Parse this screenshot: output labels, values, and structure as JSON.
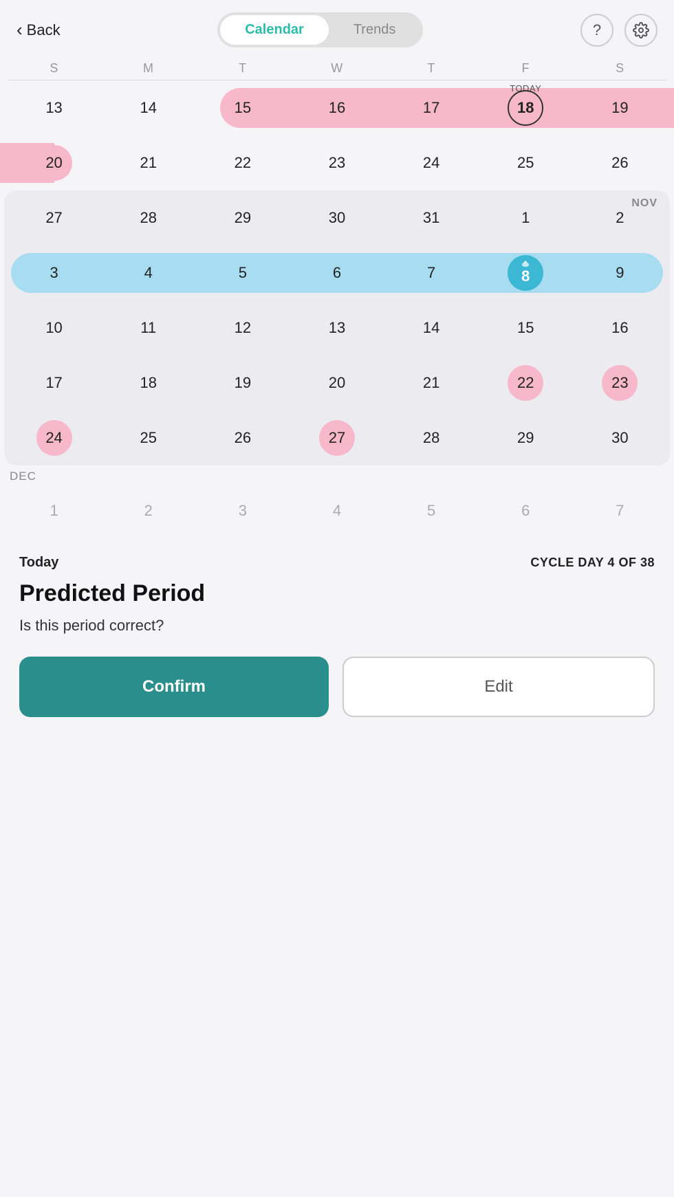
{
  "header": {
    "back_label": "Back",
    "calendar_label": "Calendar",
    "trends_label": "Trends",
    "active_tab": "Calendar"
  },
  "day_headers": [
    "S",
    "M",
    "T",
    "W",
    "T",
    "F",
    "S"
  ],
  "weeks": [
    {
      "id": "week1",
      "section": "oct",
      "days": [
        {
          "num": "13",
          "muted": false,
          "today": false,
          "pink": false,
          "blue": false,
          "ovulation": false,
          "pill_pos": "none"
        },
        {
          "num": "14",
          "muted": false,
          "today": false,
          "pink": false,
          "blue": false,
          "ovulation": false,
          "pill_pos": "none"
        },
        {
          "num": "15",
          "muted": false,
          "today": false,
          "pink": true,
          "blue": false,
          "ovulation": false,
          "pill_pos": "start"
        },
        {
          "num": "16",
          "muted": false,
          "today": false,
          "pink": true,
          "blue": false,
          "ovulation": false,
          "pill_pos": "mid"
        },
        {
          "num": "17",
          "muted": false,
          "today": false,
          "pink": true,
          "blue": false,
          "ovulation": false,
          "pill_pos": "mid"
        },
        {
          "num": "18",
          "muted": false,
          "today": true,
          "pink": true,
          "blue": false,
          "ovulation": false,
          "pill_pos": "mid"
        },
        {
          "num": "19",
          "muted": false,
          "today": false,
          "pink": true,
          "blue": false,
          "ovulation": false,
          "pill_pos": "end"
        }
      ]
    },
    {
      "id": "week2",
      "section": "oct",
      "days": [
        {
          "num": "20",
          "muted": false,
          "today": false,
          "pink": true,
          "blue": false,
          "ovulation": false,
          "pill_pos": "solo"
        },
        {
          "num": "21",
          "muted": false,
          "today": false,
          "pink": false,
          "blue": false,
          "ovulation": false,
          "pill_pos": "none"
        },
        {
          "num": "22",
          "muted": false,
          "today": false,
          "pink": false,
          "blue": false,
          "ovulation": false,
          "pill_pos": "none"
        },
        {
          "num": "23",
          "muted": false,
          "today": false,
          "pink": false,
          "blue": false,
          "ovulation": false,
          "pill_pos": "none"
        },
        {
          "num": "24",
          "muted": false,
          "today": false,
          "pink": false,
          "blue": false,
          "ovulation": false,
          "pill_pos": "none"
        },
        {
          "num": "25",
          "muted": false,
          "today": false,
          "pink": false,
          "blue": false,
          "ovulation": false,
          "pill_pos": "none"
        },
        {
          "num": "26",
          "muted": false,
          "today": false,
          "pink": false,
          "blue": false,
          "ovulation": false,
          "pill_pos": "none"
        }
      ]
    },
    {
      "id": "week3",
      "section": "oct_nov",
      "month_label": "NOV",
      "days": [
        {
          "num": "27",
          "muted": false,
          "today": false,
          "pink": false,
          "blue": false,
          "ovulation": false,
          "pill_pos": "none"
        },
        {
          "num": "28",
          "muted": false,
          "today": false,
          "pink": false,
          "blue": false,
          "ovulation": false,
          "pill_pos": "none"
        },
        {
          "num": "29",
          "muted": false,
          "today": false,
          "pink": false,
          "blue": false,
          "ovulation": false,
          "pill_pos": "none"
        },
        {
          "num": "30",
          "muted": false,
          "today": false,
          "pink": false,
          "blue": false,
          "ovulation": false,
          "pill_pos": "none"
        },
        {
          "num": "31",
          "muted": false,
          "today": false,
          "pink": false,
          "blue": false,
          "ovulation": false,
          "pill_pos": "none"
        },
        {
          "num": "1",
          "muted": false,
          "today": false,
          "pink": false,
          "blue": false,
          "ovulation": false,
          "pill_pos": "none"
        },
        {
          "num": "2",
          "muted": false,
          "today": false,
          "pink": false,
          "blue": false,
          "ovulation": false,
          "pill_pos": "none"
        }
      ]
    },
    {
      "id": "week4",
      "section": "nov",
      "days": [
        {
          "num": "3",
          "muted": false,
          "today": false,
          "pink": false,
          "blue": true,
          "ovulation": false,
          "pill_pos": "start"
        },
        {
          "num": "4",
          "muted": false,
          "today": false,
          "pink": false,
          "blue": true,
          "ovulation": false,
          "pill_pos": "mid"
        },
        {
          "num": "5",
          "muted": false,
          "today": false,
          "pink": false,
          "blue": true,
          "ovulation": false,
          "pill_pos": "mid"
        },
        {
          "num": "6",
          "muted": false,
          "today": false,
          "pink": false,
          "blue": true,
          "ovulation": false,
          "pill_pos": "mid"
        },
        {
          "num": "7",
          "muted": false,
          "today": false,
          "pink": false,
          "blue": true,
          "ovulation": false,
          "pill_pos": "mid"
        },
        {
          "num": "8",
          "muted": false,
          "today": false,
          "pink": false,
          "blue": true,
          "ovulation": true,
          "pill_pos": "mid"
        },
        {
          "num": "9",
          "muted": false,
          "today": false,
          "pink": false,
          "blue": true,
          "ovulation": false,
          "pill_pos": "end"
        }
      ]
    },
    {
      "id": "week5",
      "section": "nov",
      "days": [
        {
          "num": "10",
          "muted": false,
          "today": false,
          "pink": false,
          "blue": false,
          "ovulation": false,
          "pill_pos": "none"
        },
        {
          "num": "11",
          "muted": false,
          "today": false,
          "pink": false,
          "blue": false,
          "ovulation": false,
          "pill_pos": "none"
        },
        {
          "num": "12",
          "muted": false,
          "today": false,
          "pink": false,
          "blue": false,
          "ovulation": false,
          "pill_pos": "none"
        },
        {
          "num": "13",
          "muted": false,
          "today": false,
          "pink": false,
          "blue": false,
          "ovulation": false,
          "pill_pos": "none"
        },
        {
          "num": "14",
          "muted": false,
          "today": false,
          "pink": false,
          "blue": false,
          "ovulation": false,
          "pill_pos": "none"
        },
        {
          "num": "15",
          "muted": false,
          "today": false,
          "pink": false,
          "blue": false,
          "ovulation": false,
          "pill_pos": "none"
        },
        {
          "num": "16",
          "muted": false,
          "today": false,
          "pink": false,
          "blue": false,
          "ovulation": false,
          "pill_pos": "none"
        }
      ]
    },
    {
      "id": "week6",
      "section": "nov",
      "days": [
        {
          "num": "17",
          "muted": false,
          "today": false,
          "pink": false,
          "blue": false,
          "ovulation": false,
          "pill_pos": "none"
        },
        {
          "num": "18",
          "muted": false,
          "today": false,
          "pink": false,
          "blue": false,
          "ovulation": false,
          "pill_pos": "none"
        },
        {
          "num": "19",
          "muted": false,
          "today": false,
          "pink": false,
          "blue": false,
          "ovulation": false,
          "pill_pos": "none"
        },
        {
          "num": "20",
          "muted": false,
          "today": false,
          "pink": false,
          "blue": false,
          "ovulation": false,
          "pill_pos": "none"
        },
        {
          "num": "21",
          "muted": false,
          "today": false,
          "pink": false,
          "blue": false,
          "ovulation": false,
          "pill_pos": "none"
        },
        {
          "num": "22",
          "muted": false,
          "today": false,
          "pink": true,
          "blue": false,
          "ovulation": false,
          "pill_pos": "start"
        },
        {
          "num": "23",
          "muted": false,
          "today": false,
          "pink": true,
          "blue": false,
          "ovulation": false,
          "pill_pos": "end"
        }
      ]
    },
    {
      "id": "week7",
      "section": "nov",
      "days": [
        {
          "num": "24",
          "muted": false,
          "today": false,
          "pink": true,
          "blue": false,
          "ovulation": false,
          "pill_pos": "start"
        },
        {
          "num": "25",
          "muted": false,
          "today": false,
          "pink": true,
          "blue": false,
          "ovulation": false,
          "pill_pos": "mid"
        },
        {
          "num": "26",
          "muted": false,
          "today": false,
          "pink": true,
          "blue": false,
          "ovulation": false,
          "pill_pos": "mid"
        },
        {
          "num": "27",
          "muted": false,
          "today": false,
          "pink": true,
          "blue": false,
          "ovulation": false,
          "pill_pos": "end"
        },
        {
          "num": "28",
          "muted": false,
          "today": false,
          "pink": false,
          "blue": false,
          "ovulation": false,
          "pill_pos": "none"
        },
        {
          "num": "29",
          "muted": false,
          "today": false,
          "pink": false,
          "blue": false,
          "ovulation": false,
          "pill_pos": "none"
        },
        {
          "num": "30",
          "muted": false,
          "today": false,
          "pink": false,
          "blue": false,
          "ovulation": false,
          "pill_pos": "none"
        }
      ]
    }
  ],
  "dec_label": "DEC",
  "partial_dec_days": [
    "1",
    "2",
    "3",
    "4",
    "5",
    "6",
    "7"
  ],
  "bottom": {
    "today_label": "Today",
    "cycle_day_label": "CYCLE DAY 4 OF 38",
    "predicted_title": "Predicted Period",
    "question": "Is this period correct?",
    "confirm_label": "Confirm",
    "edit_label": "Edit"
  }
}
